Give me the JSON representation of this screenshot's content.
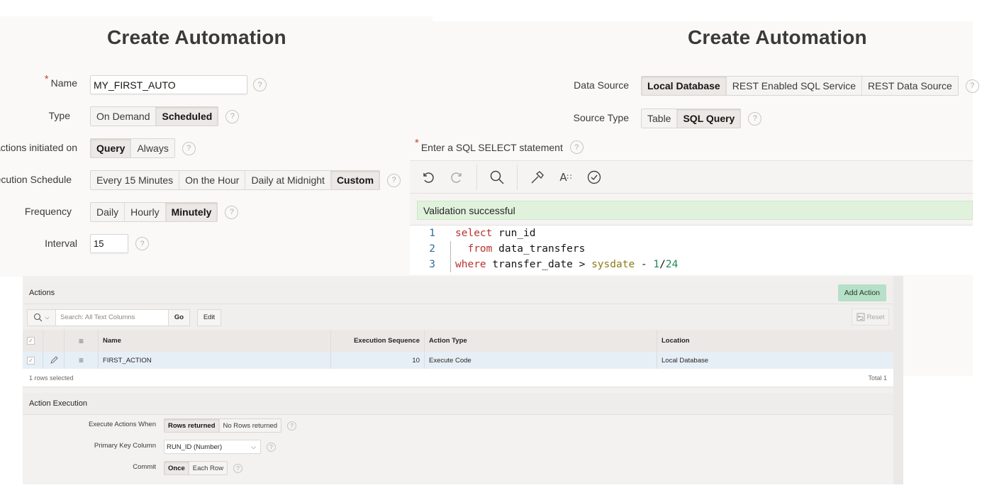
{
  "left_panel": {
    "title": "Create Automation",
    "name": {
      "label": "Name",
      "required": "*",
      "value": "MY_FIRST_AUTO"
    },
    "type": {
      "label": "Type",
      "options": [
        "On Demand",
        "Scheduled"
      ],
      "selected": "Scheduled"
    },
    "actions_initiated_on": {
      "label": "Actions initiated on",
      "options": [
        "Query",
        "Always"
      ],
      "selected": "Query"
    },
    "execution_schedule": {
      "label": "Execution Schedule",
      "options": [
        "Every 15 Minutes",
        "On the Hour",
        "Daily at Midnight",
        "Custom"
      ],
      "selected": "Custom"
    },
    "frequency": {
      "label": "Frequency",
      "options": [
        "Daily",
        "Hourly",
        "Minutely"
      ],
      "selected": "Minutely"
    },
    "interval": {
      "label": "Interval",
      "value": "15"
    },
    "help_glyph": "?"
  },
  "right_panel": {
    "title": "Create Automation",
    "data_source": {
      "label": "Data Source",
      "options": [
        "Local Database",
        "REST Enabled SQL Service",
        "REST Data Source"
      ],
      "selected": "Local Database"
    },
    "source_type": {
      "label": "Source Type",
      "options": [
        "Table",
        "SQL Query"
      ],
      "selected": "SQL Query"
    },
    "sql_label": {
      "required": "*",
      "text": "Enter a SQL SELECT statement"
    },
    "toolbar_icons": [
      "undo-icon",
      "redo-icon",
      "search-icon",
      "hammer-icon",
      "autocomplete-icon",
      "validate-icon"
    ],
    "validation_message": "Validation successful",
    "code_lines": [
      {
        "num": "1",
        "tokens": [
          {
            "t": "select",
            "c": "kw"
          },
          {
            "t": " run_id",
            "c": "id"
          }
        ]
      },
      {
        "num": "2",
        "tokens": [
          {
            "t": "  from",
            "c": "kw"
          },
          {
            "t": " data_transfers",
            "c": "id"
          }
        ]
      },
      {
        "num": "3",
        "tokens": [
          {
            "t": "where",
            "c": "kw"
          },
          {
            "t": " transfer_date > ",
            "c": "id"
          },
          {
            "t": "sysdate",
            "c": "fn"
          },
          {
            "t": " - ",
            "c": "id"
          },
          {
            "t": "1",
            "c": "num"
          },
          {
            "t": "/",
            "c": "id"
          },
          {
            "t": "24",
            "c": "num"
          }
        ]
      }
    ]
  },
  "actions_region": {
    "title": "Actions",
    "add_button": "Add Action",
    "search_placeholder": "Search: All Text Columns",
    "go_button": "Go",
    "edit_button": "Edit",
    "reset_button": "Reset",
    "columns": [
      "Name",
      "Execution Sequence",
      "Action Type",
      "Location"
    ],
    "rows": [
      {
        "name": "FIRST_ACTION",
        "execution_sequence": "10",
        "action_type": "Execute Code",
        "location": "Local Database",
        "selected": true
      }
    ],
    "footer_left": "1 rows selected",
    "footer_right": "Total 1"
  },
  "action_execution": {
    "title": "Action Execution",
    "execute_when": {
      "label": "Execute Actions When",
      "options": [
        "Rows returned",
        "No Rows returned"
      ],
      "selected": "Rows returned"
    },
    "primary_key": {
      "label": "Primary Key Column",
      "value": "RUN_ID (Number)"
    },
    "commit": {
      "label": "Commit",
      "options": [
        "Once",
        "Each Row"
      ],
      "selected": "Once"
    }
  }
}
